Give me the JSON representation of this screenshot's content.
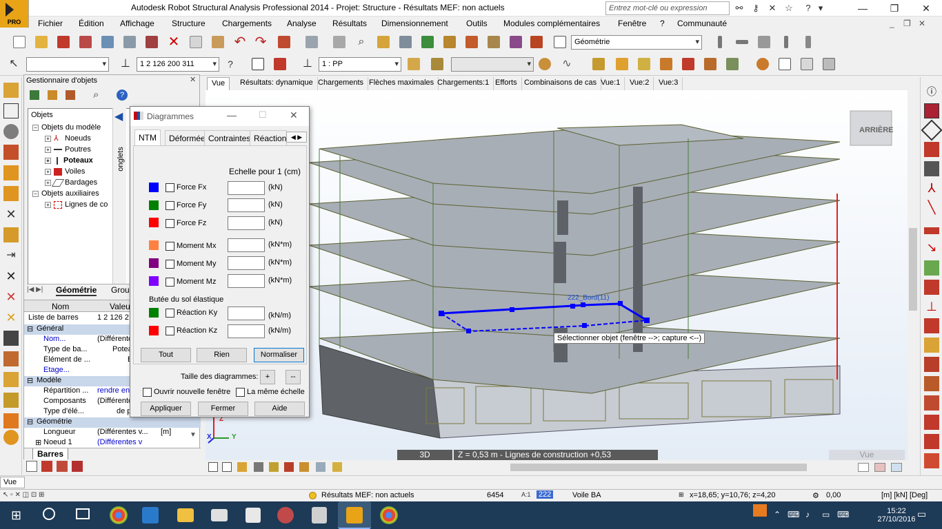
{
  "window": {
    "title": "Autodesk Robot Structural Analysis Professional 2014 - Projet: Structure - Résultats MEF: non actuels",
    "logo_text": "PRO",
    "help_search_placeholder": "Entrez mot-clé ou expression",
    "controls": [
      "—",
      "❐",
      "✕"
    ]
  },
  "menu": {
    "items": [
      "Fichier",
      "Édition",
      "Affichage",
      "Structure",
      "Chargements",
      "Analyse",
      "Résultats",
      "Dimensionnement",
      "Outils",
      "Modules complémentaires",
      "Fenêtre",
      "?",
      "Communauté"
    ]
  },
  "toolbar2": {
    "bar_selection": "1 2 126 200 311",
    "case_selection": "1 : PP",
    "layout_combo": "Géométrie"
  },
  "object_manager": {
    "title": "Gestionnaire d'objets",
    "vertical_tab": "onglets",
    "tree_header": "Objets",
    "tree": [
      {
        "label": "Objets du modèle",
        "level": 0,
        "bold": false
      },
      {
        "label": "Noeuds",
        "level": 1,
        "bold": false
      },
      {
        "label": "Poutres",
        "level": 1,
        "bold": false
      },
      {
        "label": "Poteaux",
        "level": 1,
        "bold": true
      },
      {
        "label": "Voiles",
        "level": 1,
        "bold": false
      },
      {
        "label": "Bardages",
        "level": 1,
        "bold": false
      },
      {
        "label": "Objets auxiliaires",
        "level": 0,
        "bold": false
      },
      {
        "label": "Lignes de co",
        "level": 1,
        "bold": false
      }
    ],
    "tabs": [
      "Géométrie",
      "Group"
    ]
  },
  "properties": {
    "col_name": "Nom",
    "col_value": "Valeu",
    "list_label": "Liste de barres",
    "list_value": "1 2 126 2",
    "rows": [
      {
        "type": "section",
        "key": "Général",
        "value": ""
      },
      {
        "type": "row",
        "key": "Nom...",
        "value": "(Différente",
        "link": true
      },
      {
        "type": "row",
        "key": "Type de ba...",
        "value": "Potea",
        "link": false
      },
      {
        "type": "row",
        "key": "Élément de ...",
        "value": "B",
        "link": false
      },
      {
        "type": "row",
        "key": "Etage...",
        "value": "",
        "link": true
      },
      {
        "type": "section",
        "key": "Modèle",
        "value": ""
      },
      {
        "type": "row",
        "key": "Répartition ...",
        "value": "rendre en c",
        "link": true
      },
      {
        "type": "row",
        "key": "Composants",
        "value": "(Différente",
        "link": false
      },
      {
        "type": "row",
        "key": "Type d'élé...",
        "value": "de p",
        "link": false
      },
      {
        "type": "section",
        "key": "Géométrie",
        "value": ""
      },
      {
        "type": "row",
        "key": "Longueur",
        "value": "(Différentes v...",
        "unit": "[m]",
        "link": false
      },
      {
        "type": "row",
        "key": "Noeud 1",
        "value": "(Différentes v",
        "link": true
      }
    ],
    "footer_tab": "Barres"
  },
  "view_tabs": [
    "Vue",
    "Résultats: dynamique",
    "Chargements",
    "Flèches maximales",
    "Chargements:1",
    "Efforts",
    "Combinaisons de cas",
    "Vue:1",
    "Vue:2",
    "Vue:3"
  ],
  "viewport": {
    "viewcube_label": "ARRIÈRE",
    "selection_label": "222_Bord(11)",
    "tooltip": "Sélectionner objet (fenêtre -->; capture <--)",
    "mode_3d": "3D",
    "level_text": "Z = 0,53 m - Lignes de construction +0,53",
    "axis_x": "X",
    "axis_y": "Y",
    "axis_z": "Z",
    "view_name": "Vue"
  },
  "dialog": {
    "title": "Diagrammes",
    "tabs": [
      "NTM",
      "Déformée",
      "Contraintes",
      "Réactions"
    ],
    "scale_label": "Echelle pour 1  (cm)",
    "rows": [
      {
        "label": "Force Fx",
        "unit": "(kN)",
        "color": "#0000ff"
      },
      {
        "label": "Force Fy",
        "unit": "(kN)",
        "color": "#008000"
      },
      {
        "label": "Force Fz",
        "unit": "(kN)",
        "color": "#ff0000"
      },
      {
        "label": "Moment Mx",
        "unit": "(kN*m)",
        "color": "#ff8040"
      },
      {
        "label": "Moment My",
        "unit": "(kN*m)",
        "color": "#800080"
      },
      {
        "label": "Moment Mz",
        "unit": "(kN*m)",
        "color": "#8000ff"
      }
    ],
    "soil_label": "Butée du sol élastique",
    "soil_rows": [
      {
        "label": "Réaction Ky",
        "unit": "(kN/m)",
        "color": "#008000"
      },
      {
        "label": "Réaction Kz",
        "unit": "(kN/m)",
        "color": "#ff0000"
      }
    ],
    "btn_all": "Tout",
    "btn_none": "Rien",
    "btn_normalize": "Normaliser",
    "size_label": "Taille des diagrammes:",
    "btn_plus": "+",
    "btn_minus": "--",
    "chk_new_window": "Ouvrir nouvelle fenêtre",
    "chk_same_scale": "La même échelle",
    "btn_apply": "Appliquer",
    "btn_close": "Fermer",
    "btn_help": "Aide"
  },
  "command_line": "Vue",
  "status": {
    "results": "Résultats MEF: non actuels",
    "count": "6454",
    "selected_id": "222",
    "object_type": "Voile BA",
    "coords": "x=18,65; y=10,76; z=4,20",
    "angle": "0,00",
    "units": "[m] [kN] [Deg]"
  },
  "taskbar": {
    "time": "15:22",
    "date": "27/10/2016"
  },
  "colors": {
    "accent": "#0000ff",
    "selection": "#0000ff",
    "slab": "#a8aeb6",
    "taskbar": "#1d3a57",
    "link": "#0000cc"
  }
}
